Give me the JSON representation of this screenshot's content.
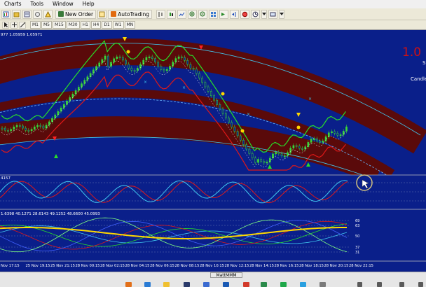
{
  "menu": [
    "Charts",
    "Tools",
    "Window",
    "Help"
  ],
  "toolbar": {
    "new_order": "New Order",
    "auto_trading": "AutoTrading"
  },
  "timeframes": [
    "M1",
    "M5",
    "M15",
    "M30",
    "H1",
    "H4",
    "D1",
    "W1",
    "MN"
  ],
  "chart": {
    "info_main": "977 1.05959 1.05971",
    "price_big": "1.0",
    "side_s": "S",
    "side_candle": "Candle",
    "osc1_label": "4157",
    "osc2_label": "1.6398 40.1271 28.6143 49.1252 48.6600 45.0993",
    "osc2_levels": [
      "69",
      "63",
      "50",
      "37",
      "31"
    ],
    "time_labels": [
      "Nov 17:15",
      "25 Nov 19:15",
      "25 Nov 21:15",
      "28 Nov 00:15",
      "28 Nov 02:15",
      "28 Nov 04:15",
      "28 Nov 06:15",
      "28 Nov 08:15",
      "28 Nov 10:15",
      "28 Nov 12:15",
      "28 Nov 14:15",
      "28 Nov 16:15",
      "28 Nov 18:15",
      "28 Nov 20:15",
      "28 Nov 22:15"
    ]
  },
  "colors": {
    "chart_bg": "#0a1f8a",
    "band_dark_red": "#5a0a0a",
    "band_blue": "#0c1f9a",
    "candle_green": "#39d639",
    "ma_green": "#28e028",
    "ma_red": "#e01818",
    "signal_yellow": "#ffd800",
    "cyan": "#40c8f0",
    "marker_red": "#ff2020"
  },
  "taskbar": {
    "window_label": "MattMMM"
  }
}
